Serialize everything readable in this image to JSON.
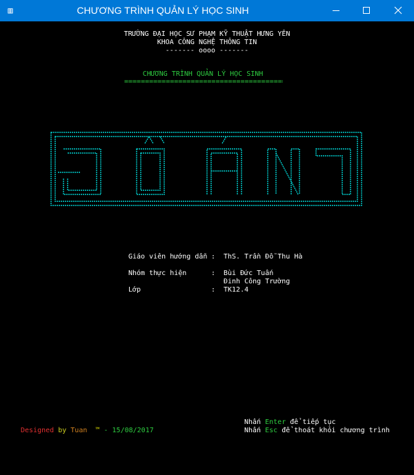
{
  "window": {
    "title": "CHƯƠNG TRÌNH QUẢN LÝ HỌC SINH",
    "icon": "console-app-icon",
    "controls": [
      "minimize-icon",
      "maximize-icon",
      "close-icon"
    ]
  },
  "header": {
    "school": "TRƯỜNG ĐẠI HỌC SƯ PHẠM KỸ THUẬT HƯNG YÊN",
    "faculty": "KHOA CÔNG NGHỆ THÔNG TIN",
    "divider": "------- oooo -------"
  },
  "panel": {
    "title": "CHƯƠNG TRÌNH QUẢN LÝ HỌC SINH",
    "underline": "==========================================",
    "banner": "ĐỒ ÁN7"
  },
  "info": {
    "advisor_label": "Giáo viên hướng dẫn",
    "advisor_value": "ThS. Trần Đỗ Thu Hà",
    "group_label": "Nhóm thực hiện",
    "group_members": [
      "Bùi Đức Tuấn",
      "Đinh Công Trường"
    ],
    "class_label": "Lớp",
    "class_value": "TK12.4",
    "separator": ":"
  },
  "footer": {
    "credit_designed": "Designed",
    "credit_by": "by",
    "credit_name": "Tuan",
    "credit_tm": "™",
    "credit_date": "- 15/08/2017",
    "enter_prefix": "Nhấn",
    "enter_key": "Enter",
    "enter_suffix": "để tiếp tục",
    "esc_prefix": "Nhấn",
    "esc_key": "Esc",
    "esc_suffix": "để thoát khỏi chương trình"
  },
  "colors": {
    "titlebar": "#0078d7",
    "accent_green": "#2ecc40",
    "banner_cyan": "#00d0d0",
    "background": "#000000"
  }
}
